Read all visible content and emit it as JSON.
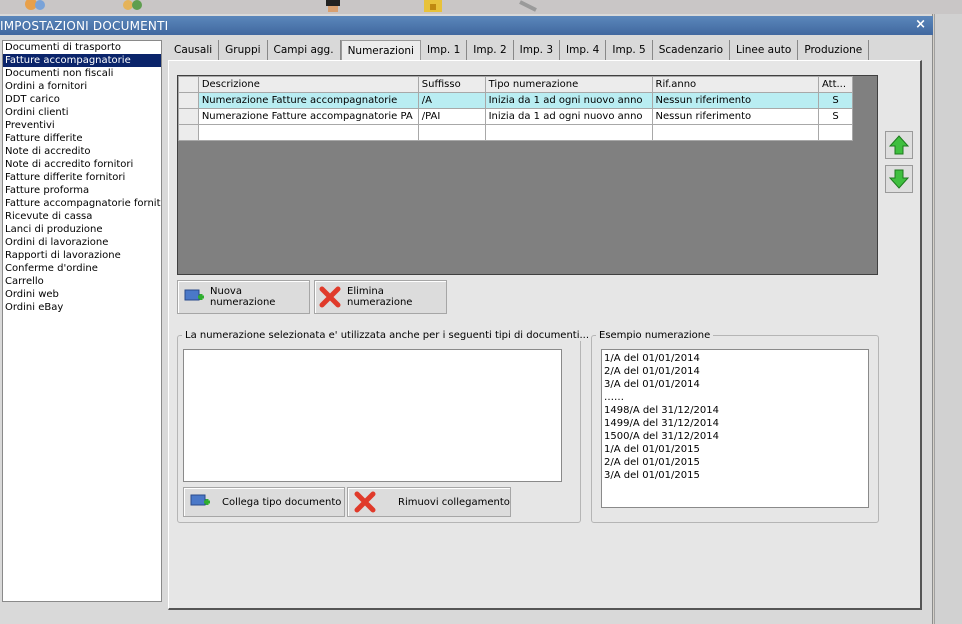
{
  "window": {
    "title": "IMPOSTAZIONI DOCUMENTI",
    "close_glyph": "×"
  },
  "toolbar_icons": [
    "users-icon",
    "user-group-icon",
    "agent-icon",
    "folder-lock-icon",
    "tools-icon"
  ],
  "document_types": [
    "Documenti di trasporto",
    "Fatture accompagnatorie",
    "Documenti non fiscali",
    "Ordini a fornitori",
    "DDT carico",
    "Ordini clienti",
    "Preventivi",
    "Fatture differite",
    "Note di accredito",
    "Note di accredito fornitori",
    "Fatture differite fornitori",
    "Fatture proforma",
    "Fatture accompagnatorie fornito",
    "Ricevute di cassa",
    "Lanci di produzione",
    "Ordini di lavorazione",
    "Rapporti di lavorazione",
    "Conferme d'ordine",
    "Carrello",
    "Ordini web",
    "Ordini eBay"
  ],
  "selected_document_type": "Fatture accompagnatorie",
  "tabs": [
    "Causali",
    "Gruppi",
    "Campi agg.",
    "Numerazioni",
    "Imp. 1",
    "Imp. 2",
    "Imp. 3",
    "Imp. 4",
    "Imp. 5",
    "Scadenzario",
    "Linee auto",
    "Produzione"
  ],
  "active_tab": "Numerazioni",
  "grid": {
    "columns": [
      "Descrizione",
      "Suffisso",
      "Tipo numerazione",
      "Rif.anno",
      "Att..."
    ],
    "rows": [
      {
        "descrizione": "Numerazione Fatture accompagnatorie",
        "suffisso": "/A",
        "tipo": "Inizia da 1 ad ogni nuovo anno",
        "rif_anno": "Nessun riferimento",
        "att": "S"
      },
      {
        "descrizione": "Numerazione Fatture accompagnatorie PA",
        "suffisso": "/PAI",
        "tipo": "Inizia da 1 ad ogni nuovo anno",
        "rif_anno": "Nessun riferimento",
        "att": "S"
      }
    ],
    "selected_row": 0
  },
  "buttons": {
    "new_numbering": "Nuova numerazione",
    "delete_numbering": "Elimina numerazione",
    "link_doc_type": "Collega tipo documento",
    "remove_link": "Rimuovi collegamento"
  },
  "linked_group": {
    "label": "La numerazione selezionata e' utilizzata anche per i seguenti tipi di documenti..."
  },
  "example_group": {
    "label": "Esempio numerazione",
    "lines": [
      "1/A del 01/01/2014",
      "2/A del 01/01/2014",
      "3/A del 01/01/2014",
      "……",
      "1498/A del 31/12/2014",
      "1499/A del 31/12/2014",
      "1500/A del 31/12/2014",
      "1/A del 01/01/2015",
      "2/A del 01/01/2015",
      "3/A del 01/01/2015"
    ]
  },
  "colors": {
    "title_bar": "#4a76ac",
    "list_selection": "#0a246a",
    "grid_selection": "#b9edf2",
    "grid_background": "#808080",
    "arrow_green": "#3fbf3f",
    "delete_red": "#e03a2a"
  }
}
